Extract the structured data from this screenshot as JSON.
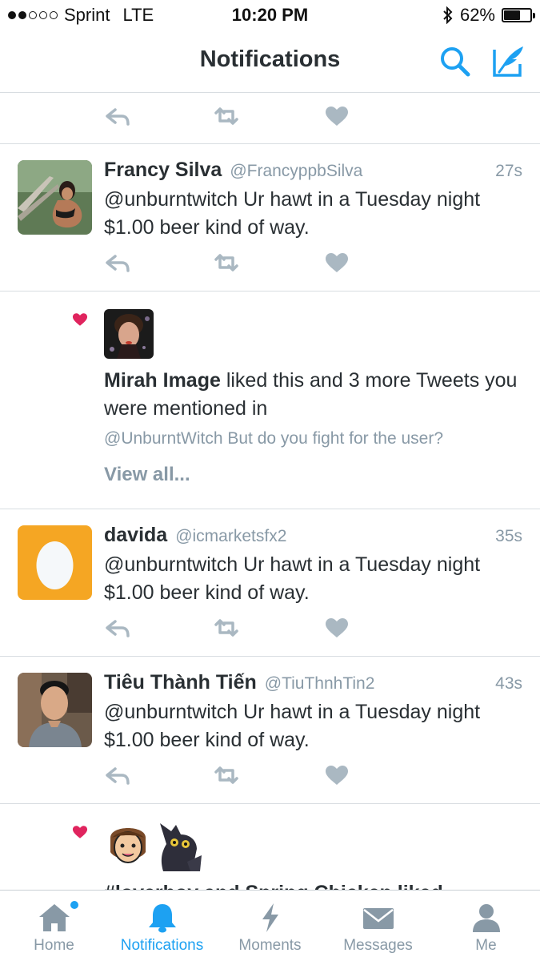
{
  "status_bar": {
    "carrier": "Sprint",
    "network": "LTE",
    "time": "10:20 PM",
    "battery_percent_label": "62%",
    "battery_level": 0.62,
    "signal_bars_filled": 2,
    "signal_bars_total": 5
  },
  "header": {
    "title": "Notifications",
    "icons": [
      "search-icon",
      "compose-icon"
    ]
  },
  "tweets": [
    {
      "name": "Francy Silva",
      "handle": "@FrancyppbSilva",
      "time": "27s",
      "text": "@unburntwitch Ur hawt in a Tuesday night $1.00 beer kind of way."
    },
    {
      "name": "davida",
      "handle": "@icmarketsfx2",
      "time": "35s",
      "text": "@unburntwitch Ur hawt in a Tuesday night $1.00 beer kind of way."
    },
    {
      "name": "Tiêu Thành Tiến",
      "handle": "@TiuThnhTin2",
      "time": "43s",
      "text": "@unburntwitch Ur hawt in a Tuesday night $1.00 beer kind of way."
    }
  ],
  "like_notification": {
    "name": "Mirah Image",
    "text": " liked this and 3 more Tweets you were mentioned in",
    "quote": "@UnburntWitch But do you fight for the user?",
    "view_all": "View all..."
  },
  "like_notification_2": {
    "text": "#loverboy and Spring Chicken liked"
  },
  "tabs": [
    {
      "label": "Home",
      "icon": "home-icon",
      "active": false,
      "has_badge": true
    },
    {
      "label": "Notifications",
      "icon": "bell-icon",
      "active": true,
      "has_badge": false
    },
    {
      "label": "Moments",
      "icon": "lightning-icon",
      "active": false,
      "has_badge": false
    },
    {
      "label": "Messages",
      "icon": "envelope-icon",
      "active": false,
      "has_badge": false
    },
    {
      "label": "Me",
      "icon": "person-icon",
      "active": false,
      "has_badge": false
    }
  ],
  "colors": {
    "accent": "#1da1f2",
    "muted": "#8899a6",
    "text": "#292f33",
    "like_red": "#e0245e",
    "egg_bg": "#f5a623"
  }
}
